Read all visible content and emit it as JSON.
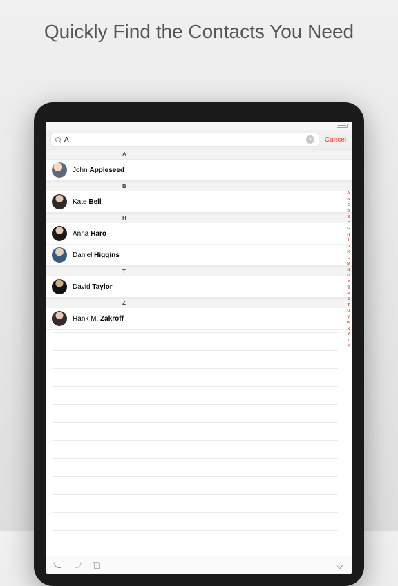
{
  "hero": {
    "title": "Quickly Find the Contacts You Need"
  },
  "search": {
    "query": "A",
    "cancel": "Cancel"
  },
  "sections": [
    {
      "letter": "A",
      "contacts": [
        {
          "first": "John",
          "last": "Appleseed",
          "avatar": "av1"
        }
      ]
    },
    {
      "letter": "B",
      "contacts": [
        {
          "first": "Kate",
          "last": "Bell",
          "avatar": "av2"
        }
      ]
    },
    {
      "letter": "H",
      "contacts": [
        {
          "first": "Anna",
          "last": "Haro",
          "avatar": "av3"
        },
        {
          "first": "Daniel",
          "last": "Higgins",
          "avatar": "av4"
        }
      ]
    },
    {
      "letter": "T",
      "contacts": [
        {
          "first": "David",
          "last": "Taylor",
          "avatar": "av5"
        }
      ]
    },
    {
      "letter": "Z",
      "contacts": [
        {
          "first": "Hank M.",
          "last": "Zakroff",
          "avatar": "av6"
        }
      ]
    }
  ],
  "index": [
    "A",
    "B",
    "C",
    "D",
    "E",
    "F",
    "G",
    "H",
    "I",
    "J",
    "K",
    "L",
    "M",
    "N",
    "O",
    "P",
    "Q",
    "R",
    "S",
    "T",
    "U",
    "V",
    "W",
    "X",
    "Y",
    "Z",
    "#"
  ]
}
